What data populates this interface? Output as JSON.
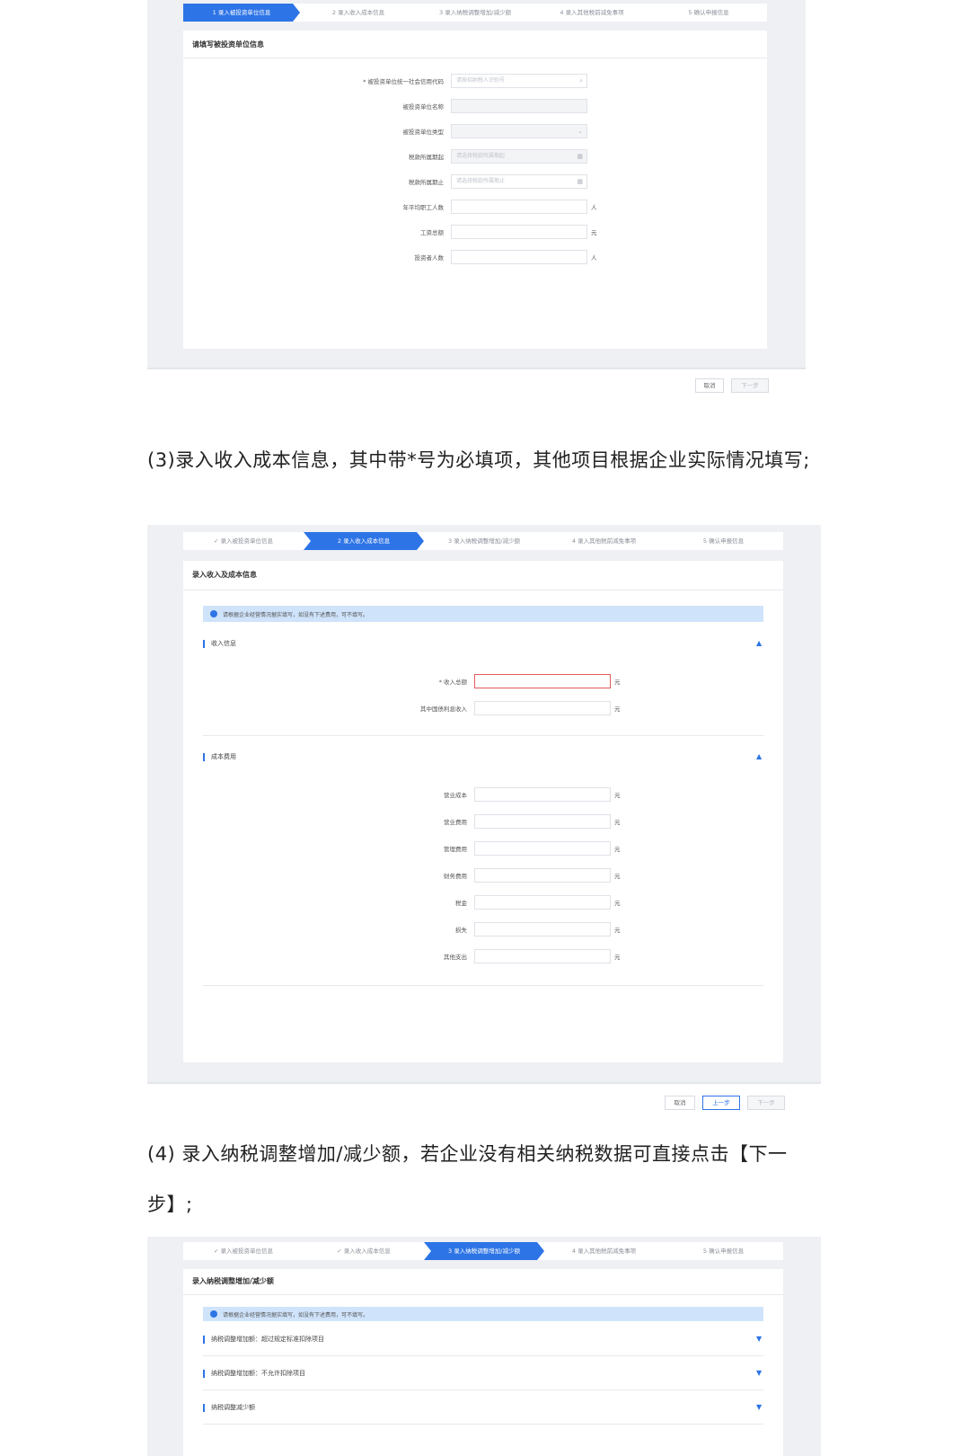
{
  "screen1": {
    "steps": [
      "1 录入被投资单位信息",
      "2 录入收入成本信息",
      "3 录入纳税调整增加/减少额",
      "4 录入其他税前减免事项",
      "5 确认申报信息"
    ],
    "section_title": "请填写被投资单位信息",
    "fields": [
      {
        "label": "* 被投资单位统一社会信用代码",
        "placeholder": "请按招纳税人识别号",
        "icon": "search-icon",
        "unit": ""
      },
      {
        "label": "被投资单位名称",
        "placeholder": "",
        "icon": "",
        "unit": ""
      },
      {
        "label": "被投资单位类型",
        "placeholder": "",
        "icon": "chevron-down-icon",
        "unit": ""
      },
      {
        "label": "税款所属期起",
        "placeholder": "请选择税款所属期起",
        "icon": "calendar-icon",
        "unit": ""
      },
      {
        "label": "税款所属期止",
        "placeholder": "请选择税款所属期止",
        "icon": "calendar-icon",
        "unit": ""
      },
      {
        "label": "年平均职工人数",
        "placeholder": "",
        "icon": "",
        "unit": "人"
      },
      {
        "label": "工资总额",
        "placeholder": "",
        "icon": "",
        "unit": "元"
      },
      {
        "label": "投资者人数",
        "placeholder": "",
        "icon": "",
        "unit": "人"
      }
    ],
    "buttons": {
      "cancel": "取消",
      "next": "下一步"
    }
  },
  "para3": "(3)录入收入成本信息，其中带*号为必填项，其他项目根据企业实际情况填写;",
  "screen2": {
    "steps": [
      "✓ 录入被投资单位信息",
      "2 录入收入成本信息",
      "3 录入纳税调整增加/减少额",
      "4 录入其他税前减免事项",
      "5 确认申报信息"
    ],
    "section_title": "录入收入及成本信息",
    "notice": "请根据企业经营情况据实填写，如没有下述费用，可不填写。",
    "group_income": "收入信息",
    "income_fields": [
      {
        "label": "* 收入总额",
        "unit": "元"
      },
      {
        "label": "其中国债利息收入",
        "unit": "元"
      }
    ],
    "group_cost": "成本费用",
    "cost_fields": [
      {
        "label": "营业成本",
        "unit": "元"
      },
      {
        "label": "营业费用",
        "unit": "元"
      },
      {
        "label": "管理费用",
        "unit": "元"
      },
      {
        "label": "财务费用",
        "unit": "元"
      },
      {
        "label": "税金",
        "unit": "元"
      },
      {
        "label": "损失",
        "unit": "元"
      },
      {
        "label": "其他支出",
        "unit": "元"
      }
    ],
    "buttons": {
      "cancel": "取消",
      "prev": "上一步",
      "next": "下一步"
    }
  },
  "para4": "(4) 录入纳税调整增加/减少额，若企业没有相关纳税数据可直接点击【下一步】;",
  "screen3": {
    "steps": [
      "✓ 录入被投资单位信息",
      "✓ 录入收入成本信息",
      "3 录入纳税调整增加/减少额",
      "4 录入其他税前减免事项",
      "5 确认申报信息"
    ],
    "section_title": "录入纳税调整增加/减少额",
    "notice": "请根据企业经营情况据实填写，如没有下述费用，可不填写。",
    "groups": [
      "纳税调整增加额：超过规定标准扣除项目",
      "纳税调整增加额：不允许扣除项目",
      "纳税调整减少额"
    ]
  },
  "colors": {
    "accent": "#2d74e6",
    "notice_bg": "#cfe3fb",
    "error": "#e25a5a"
  }
}
